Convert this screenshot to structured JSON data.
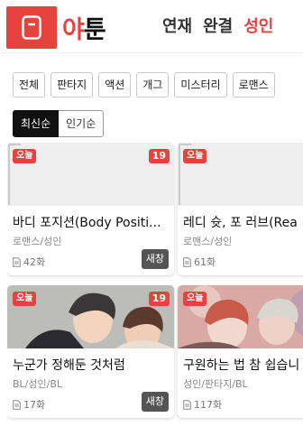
{
  "header": {
    "logo_text_a": "야",
    "logo_text_b": "툰",
    "nav": [
      "연재",
      "완결",
      "성인"
    ],
    "accent_color": "#e8423e"
  },
  "genres": [
    "전체",
    "판타지",
    "액션",
    "개그",
    "미스터리",
    "로맨스"
  ],
  "sorts": [
    "최신순",
    "인기순"
  ],
  "cards": [
    {
      "title": "바디 포지션(Body Positi...",
      "tags": "로맨스/성인",
      "episodes": "42화",
      "today": "오늘",
      "age": "19",
      "new": "새창",
      "thumb": "blank"
    },
    {
      "title": "레디 슛, 포 러브(Rea",
      "tags": "로맨스/성인",
      "episodes": "61화",
      "today": "오늘",
      "age": "",
      "new": "",
      "thumb": "blank"
    },
    {
      "title": "누군가 정해둔 것처럼",
      "tags": "BL/성인/BL",
      "episodes": "17화",
      "today": "오늘",
      "age": "19",
      "new": "새창",
      "thumb": "art1"
    },
    {
      "title": "구원하는 법 참 쉽습니",
      "tags": "성인/판타지/BL",
      "episodes": "117화",
      "today": "오늘",
      "age": "",
      "new": "",
      "thumb": "art2"
    }
  ]
}
